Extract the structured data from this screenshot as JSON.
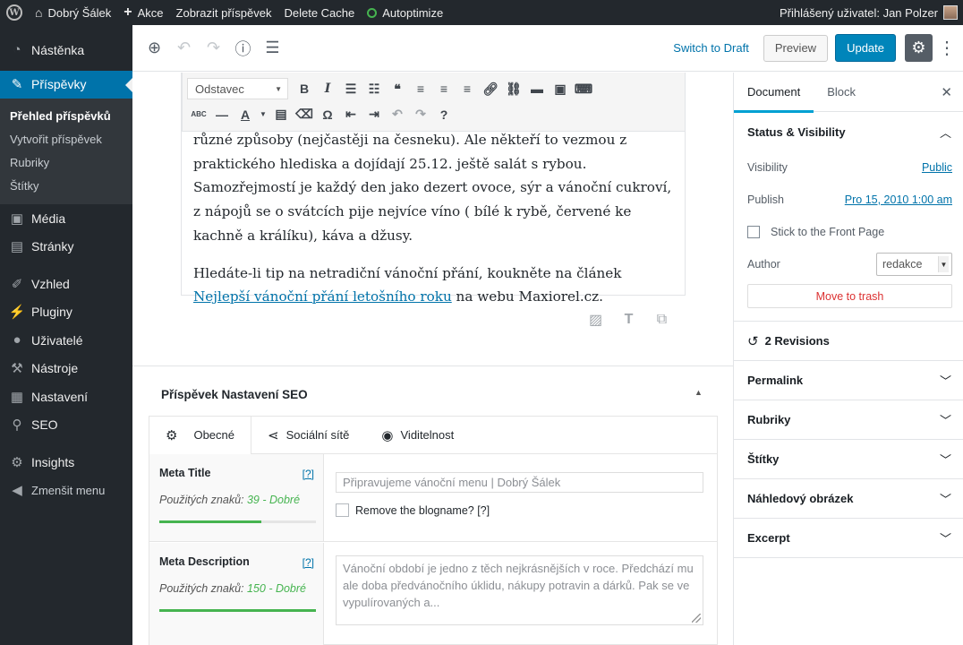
{
  "adminbar": {
    "site_name": "Dobrý Šálek",
    "new_label": "Akce",
    "view_post": "Zobrazit příspěvek",
    "delete_cache": "Delete Cache",
    "autoptimize": "Autoptimize",
    "user_greeting": "Přihlášený uživatel: Jan Polzer"
  },
  "menu": {
    "dashboard": "Nástěnka",
    "posts": "Příspěvky",
    "posts_sub": [
      "Přehled příspěvků",
      "Vytvořit příspěvek",
      "Rubriky",
      "Štítky"
    ],
    "media": "Média",
    "pages": "Stránky",
    "appearance": "Vzhled",
    "plugins": "Pluginy",
    "users": "Uživatelé",
    "tools": "Nástroje",
    "settings": "Nastavení",
    "seo": "SEO",
    "insights": "Insights",
    "collapse": "Zmenšit menu"
  },
  "header": {
    "switch_to_draft": "Switch to Draft",
    "preview": "Preview",
    "update": "Update"
  },
  "toolbar": {
    "format_select": "Odstavec"
  },
  "content": {
    "para1": "různé způsoby (nejčastěji na česneku). Ale někteří to vezmou z praktického hlediska a dojídají 25.12. ještě salát s rybou. Samozřejmostí je každý den jako dezert ovoce, sýr a vánoční cukroví, z nápojů se o svátcích pije nejvíce víno ( bílé k rybě, červené ke kachně a králíku), káva a džusy.",
    "para2_before": "Hledáte-li tip na netradiční vánoční přání, koukněte na článek ",
    "para2_link": "Nejlepší vánoční přání letošního roku",
    "para2_after": " na webu Maxiorel.cz."
  },
  "seo": {
    "box_title": "Příspěvek Nastavení SEO",
    "tabs": [
      "Obecné",
      "Sociální sítě",
      "Viditelnost"
    ],
    "meta_title_label": "Meta Title",
    "meta_title_help": "[?]",
    "meta_title_count_prefix": "Použitých znaků:",
    "meta_title_count_value": "39 - Dobré",
    "meta_title_fill": 0.65,
    "meta_title_placeholder": "Připravujeme vánoční menu | Dobrý Šálek",
    "remove_blogname": "Remove the blogname? [?]",
    "meta_desc_label": "Meta Description",
    "meta_desc_help": "[?]",
    "meta_desc_count_prefix": "Použitých znaků:",
    "meta_desc_count_value": "150 - Dobré",
    "meta_desc_fill": 1.0,
    "meta_desc_placeholder": "Vánoční období je jedno z těch nejkrásnějších v roce. Předchází mu ale doba předvánočního úklidu, nákupy potravin a dárků. Pak se ve vypulírovaných a..."
  },
  "sidebar": {
    "tab_document": "Document",
    "tab_block": "Block",
    "status_visibility": "Status & Visibility",
    "visibility_label": "Visibility",
    "visibility_value": "Public",
    "publish_label": "Publish",
    "publish_value": "Pro 15, 2010 1:00 am",
    "stick_front": "Stick to the Front Page",
    "author_label": "Author",
    "author_value": "redakce",
    "move_trash": "Move to trash",
    "revisions": "2 Revisions",
    "panels": [
      "Permalink",
      "Rubriky",
      "Štítky",
      "Náhledový obrázek",
      "Excerpt"
    ]
  }
}
